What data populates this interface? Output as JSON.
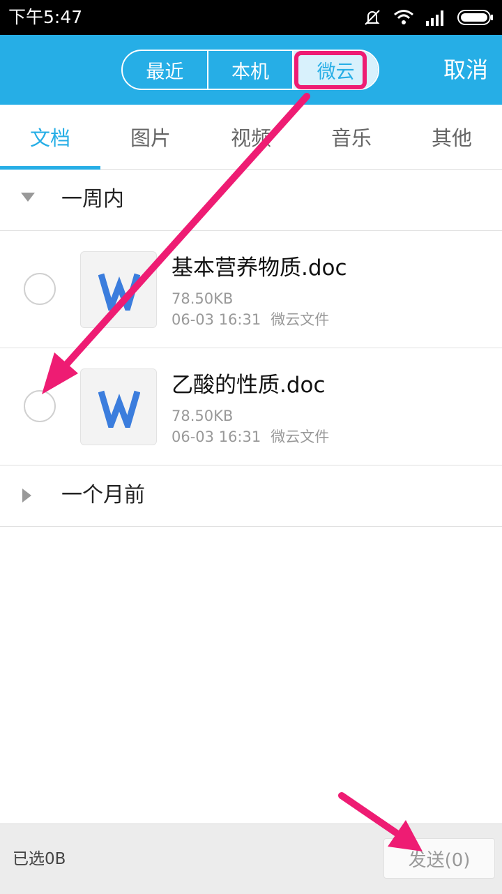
{
  "status_bar": {
    "time": "下午5:47",
    "icons": [
      "mute-icon",
      "wifi-icon",
      "signal-icon",
      "battery-icon"
    ]
  },
  "top_bar": {
    "segments": [
      {
        "label": "最近",
        "active": false
      },
      {
        "label": "本机",
        "active": false
      },
      {
        "label": "微云",
        "active": true
      }
    ],
    "cancel_label": "取消",
    "accent_color": "#26aee6"
  },
  "tabs": [
    {
      "label": "文档",
      "active": true
    },
    {
      "label": "图片",
      "active": false
    },
    {
      "label": "视频",
      "active": false
    },
    {
      "label": "音乐",
      "active": false
    },
    {
      "label": "其他",
      "active": false
    }
  ],
  "groups": [
    {
      "label": "一周内",
      "expanded": true,
      "files": [
        {
          "name": "基本营养物质.doc",
          "size": "78.50KB",
          "date": "06-03 16:31",
          "source": "微云文件",
          "icon": "word-doc-icon"
        },
        {
          "name": "乙酸的性质.doc",
          "size": "78.50KB",
          "date": "06-03 16:31",
          "source": "微云文件",
          "icon": "word-doc-icon"
        }
      ]
    },
    {
      "label": "一个月前",
      "expanded": false,
      "files": []
    }
  ],
  "bottom_bar": {
    "selected_info": "已选0B",
    "send_label": "发送(0)"
  },
  "annotation_color": "#ee1c73"
}
